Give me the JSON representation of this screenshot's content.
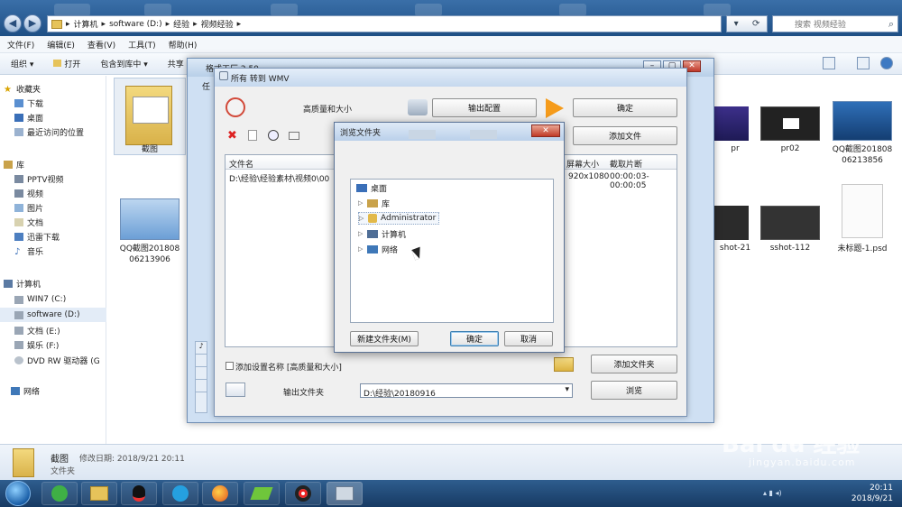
{
  "explorer": {
    "breadcrumb": [
      "计算机",
      "software (D:)",
      "经验",
      "视频经验"
    ],
    "search_placeholder": "搜索 视频经验",
    "menu": [
      "文件(F)",
      "编辑(E)",
      "查看(V)",
      "工具(T)",
      "帮助(H)"
    ],
    "toolbar": [
      "组织 ▾",
      "打开",
      "包含到库中 ▾",
      "共享"
    ],
    "nav": {
      "favorites_header": "收藏夹",
      "favorites": [
        "下载",
        "桌面",
        "最近访问的位置"
      ],
      "libraries_header": "库",
      "libraries": [
        "PPTV视频",
        "视频",
        "图片",
        "文档",
        "迅雷下载",
        "音乐"
      ],
      "computer_header": "计算机",
      "drives": [
        "WIN7 (C:)",
        "software (D:)",
        "文档 (E:)",
        "娱乐 (F:)",
        "DVD RW 驱动器 (G"
      ],
      "network": "网络"
    },
    "files": {
      "f1": "截图",
      "f2": "QQ截图20180806213906",
      "f3": "pr",
      "f4": "pr02",
      "f5": "QQ截图20180806213856",
      "f6": "shot-21",
      "f7": "sshot-112",
      "f8": "未标题-1.psd"
    },
    "details": {
      "name": "截图",
      "modified": "修改日期: 2018/9/21 20:11",
      "type": "文件夹"
    }
  },
  "formatfactory": {
    "title": "格式工厂 2.50",
    "tab_partial": "任"
  },
  "convert_dialog": {
    "title": "所有 转到 WMV",
    "quality": "高质量和大小",
    "output_config": "输出配置",
    "ok": "确定",
    "add_file": "添加文件",
    "columns": {
      "filename": "文件名",
      "screen_size": "屏幕大小",
      "clip": "截取片断"
    },
    "row": {
      "filename": "D:\\经验\\经验素材\\视频0\\00",
      "screen_size": "920x1080",
      "clip": "00:00:03-00:00:05"
    },
    "add_setting_name": "添加设置名称 [高质量和大小]",
    "add_folder": "添加文件夹",
    "output_folder_label": "输出文件夹",
    "output_folder_value": "D:\\经验\\20180916",
    "browse": "浏览"
  },
  "browse_dialog": {
    "title": "浏览文件夹",
    "tree": [
      "桌面",
      "库",
      "Administrator",
      "计算机",
      "网络"
    ],
    "new_folder": "新建文件夹(M)",
    "ok": "确定",
    "cancel": "取消"
  },
  "taskbar": {
    "time": "20:11",
    "date": "2018/9/21"
  },
  "watermark": {
    "brand": "Bai du 经验",
    "url": "jingyan.baidu.com"
  }
}
